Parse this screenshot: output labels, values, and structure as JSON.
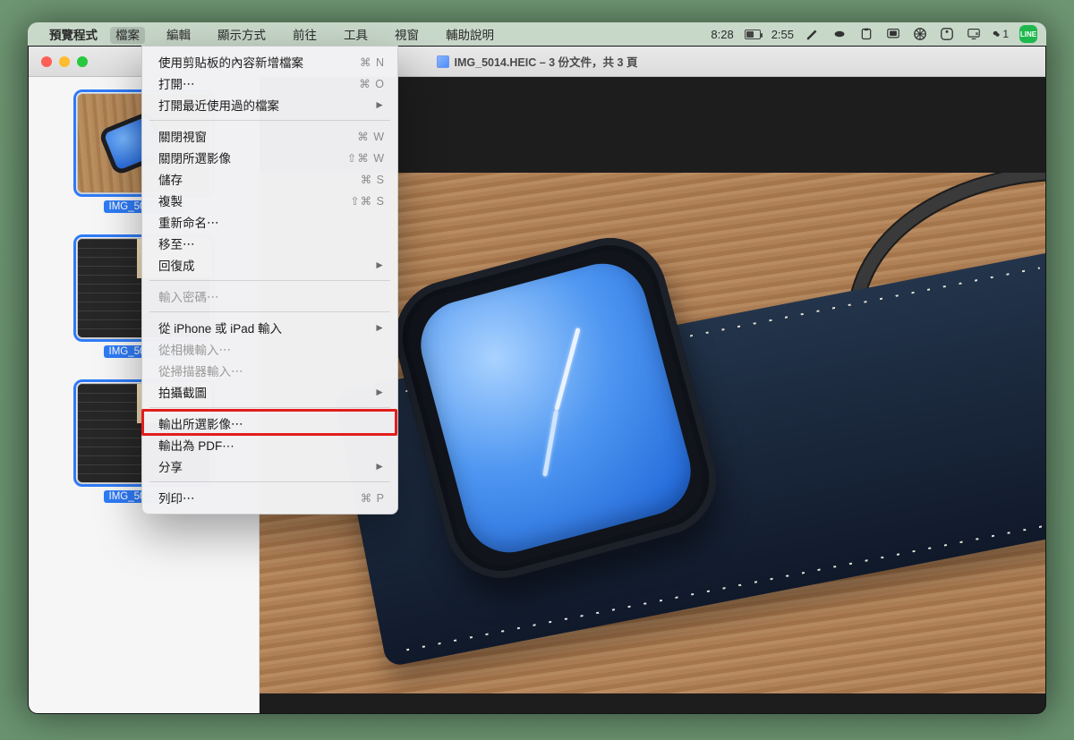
{
  "menubar": {
    "app_name": "預覽程式",
    "items": [
      "檔案",
      "編輯",
      "顯示方式",
      "前往",
      "工具",
      "視窗",
      "輔助說明"
    ],
    "open_index": 0,
    "status_time1": "8:28",
    "status_time2": "2:55",
    "wechat_count": "1",
    "line_label": "LINE"
  },
  "window": {
    "title": "IMG_5014.HEIC – 3 份文件，共 3 頁"
  },
  "sidebar": {
    "items": [
      {
        "name": "IMG_5014.heic",
        "selected": true,
        "kind": "watch"
      },
      {
        "name": "IMG_5018.heic",
        "selected": true,
        "kind": "keyboard"
      },
      {
        "name": "IMG_5019.heic",
        "selected": true,
        "kind": "keyboard"
      }
    ]
  },
  "dropdown": {
    "rows": [
      {
        "label": "使用剪貼板的內容新增檔案",
        "hk": "⌘ N"
      },
      {
        "label": "打開⋯",
        "hk": "⌘ O"
      },
      {
        "label": "打開最近使用過的檔案",
        "sub": true
      },
      {
        "sep": true
      },
      {
        "label": "關閉視窗",
        "hk": "⌘ W"
      },
      {
        "label": "關閉所選影像",
        "hk": "⇧⌘ W"
      },
      {
        "label": "儲存",
        "hk": "⌘ S"
      },
      {
        "label": "複製",
        "hk": "⇧⌘ S"
      },
      {
        "label": "重新命名⋯"
      },
      {
        "label": "移至⋯"
      },
      {
        "label": "回復成",
        "sub": true
      },
      {
        "sep": true
      },
      {
        "label": "輸入密碼⋯",
        "disabled": true
      },
      {
        "sep": true
      },
      {
        "label": "從 iPhone 或 iPad 輸入",
        "sub": true
      },
      {
        "label": "從相機輸入⋯",
        "disabled": true
      },
      {
        "label": "從掃描器輸入⋯",
        "disabled": true
      },
      {
        "label": "拍攝截圖",
        "sub": true
      },
      {
        "sep": true
      },
      {
        "label": "輸出所選影像⋯",
        "highlight": true
      },
      {
        "label": "輸出為 PDF⋯"
      },
      {
        "label": "分享",
        "sub": true
      },
      {
        "sep": true
      },
      {
        "label": "列印⋯",
        "hk": "⌘ P"
      }
    ]
  }
}
